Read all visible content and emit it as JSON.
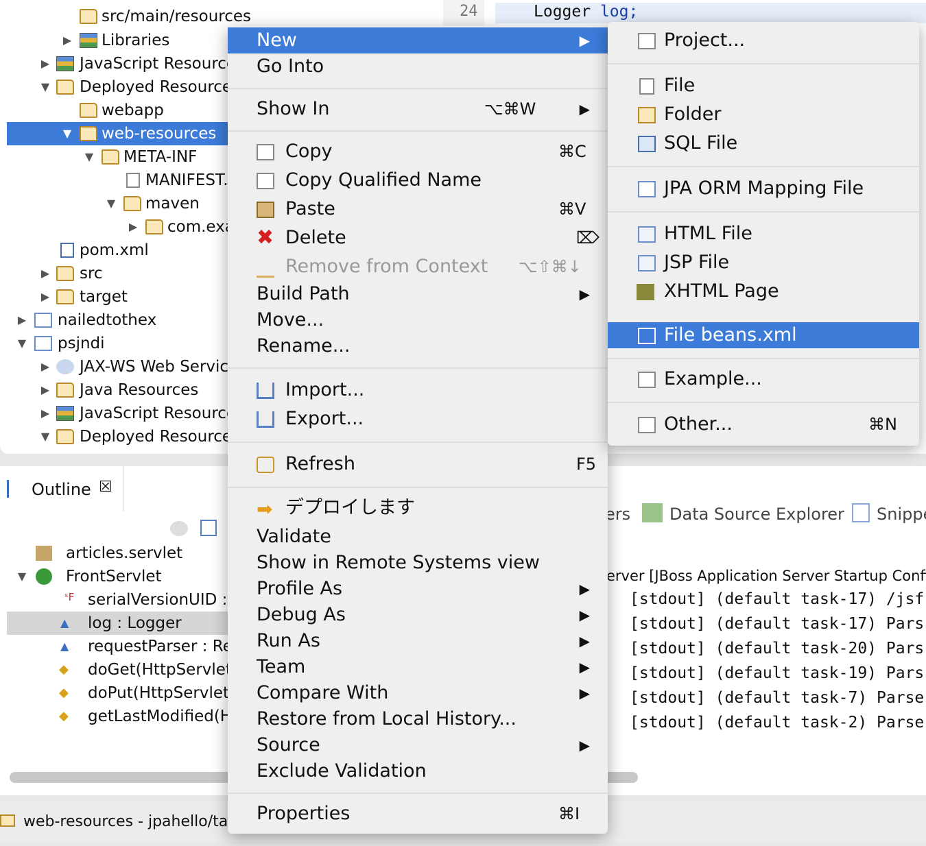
{
  "explorer": {
    "rows": [
      {
        "label": "src/main/resources"
      },
      {
        "label": "Libraries"
      },
      {
        "label": "JavaScript Resources"
      },
      {
        "label": "Deployed Resources"
      },
      {
        "label": "webapp"
      },
      {
        "label": "web-resources"
      },
      {
        "label": "META-INF"
      },
      {
        "label": "MANIFEST.M"
      },
      {
        "label": "maven"
      },
      {
        "label": "com.exa"
      },
      {
        "label": "pom.xml"
      },
      {
        "label": "src"
      },
      {
        "label": "target"
      },
      {
        "label": "nailedtothex"
      },
      {
        "label": "psjndi"
      },
      {
        "label": "JAX-WS Web Services"
      },
      {
        "label": "Java Resources"
      },
      {
        "label": "JavaScript Resources"
      },
      {
        "label": "Deployed Resources"
      }
    ]
  },
  "editor": {
    "line_number": "24",
    "code_type": "Logger",
    "code_var": "log;"
  },
  "outline": {
    "tab_label": "Outline",
    "rows": [
      {
        "label": "articles.servlet"
      },
      {
        "label": "FrontServlet"
      },
      {
        "label": "serialVersionUID : l"
      },
      {
        "label": "log : Logger"
      },
      {
        "label": "requestParser : Req"
      },
      {
        "label": "doGet(HttpServletR"
      },
      {
        "label": "doPut(HttpServletR"
      },
      {
        "label": "getLastModified(Ht"
      }
    ]
  },
  "console": {
    "tabs": [
      "ers",
      "Data Source Explorer",
      "Snippe"
    ],
    "server_line": "erver [JBoss Application Server Startup Confi",
    "lines": [
      "[stdout] (default task-17) /jsf",
      "[stdout] (default task-17) Pars",
      "[stdout] (default task-20) Pars",
      "[stdout] (default task-19) Pars",
      "[stdout] (default task-7) Parse",
      "[stdout] (default task-2) Parse"
    ]
  },
  "status": {
    "path": "web-resources - jpahello/ta"
  },
  "context_menu": {
    "items": {
      "new": "New",
      "go_into": "Go Into",
      "show_in": "Show In",
      "show_in_sc": "⌥⌘W",
      "copy": "Copy",
      "copy_sc": "⌘C",
      "copy_qualified": "Copy Qualified Name",
      "paste": "Paste",
      "paste_sc": "⌘V",
      "delete": "Delete",
      "delete_sc": "⌦",
      "remove_context": "Remove from Context",
      "remove_context_sc": "⌥⇧⌘↓",
      "build_path": "Build Path",
      "move": "Move...",
      "rename": "Rename...",
      "import": "Import...",
      "export": "Export...",
      "refresh": "Refresh",
      "refresh_sc": "F5",
      "deploy": "デプロイします",
      "validate": "Validate",
      "show_remote": "Show in Remote Systems view",
      "profile_as": "Profile As",
      "debug_as": "Debug As",
      "run_as": "Run As",
      "team": "Team",
      "compare_with": "Compare With",
      "restore_history": "Restore from Local History...",
      "source": "Source",
      "exclude_validation": "Exclude Validation",
      "properties": "Properties",
      "properties_sc": "⌘I"
    }
  },
  "submenu": {
    "items": {
      "project": "Project...",
      "file": "File",
      "folder": "Folder",
      "sql_file": "SQL File",
      "jpa_orm": "JPA ORM Mapping File",
      "html_file": "HTML File",
      "jsp_file": "JSP File",
      "xhtml_page": "XHTML Page",
      "beans_xml": "File beans.xml",
      "example": "Example...",
      "other": "Other...",
      "other_sc": "⌘N"
    }
  },
  "colors": {
    "selection": "#3d7bd9",
    "menu_bg": "#efefef"
  }
}
